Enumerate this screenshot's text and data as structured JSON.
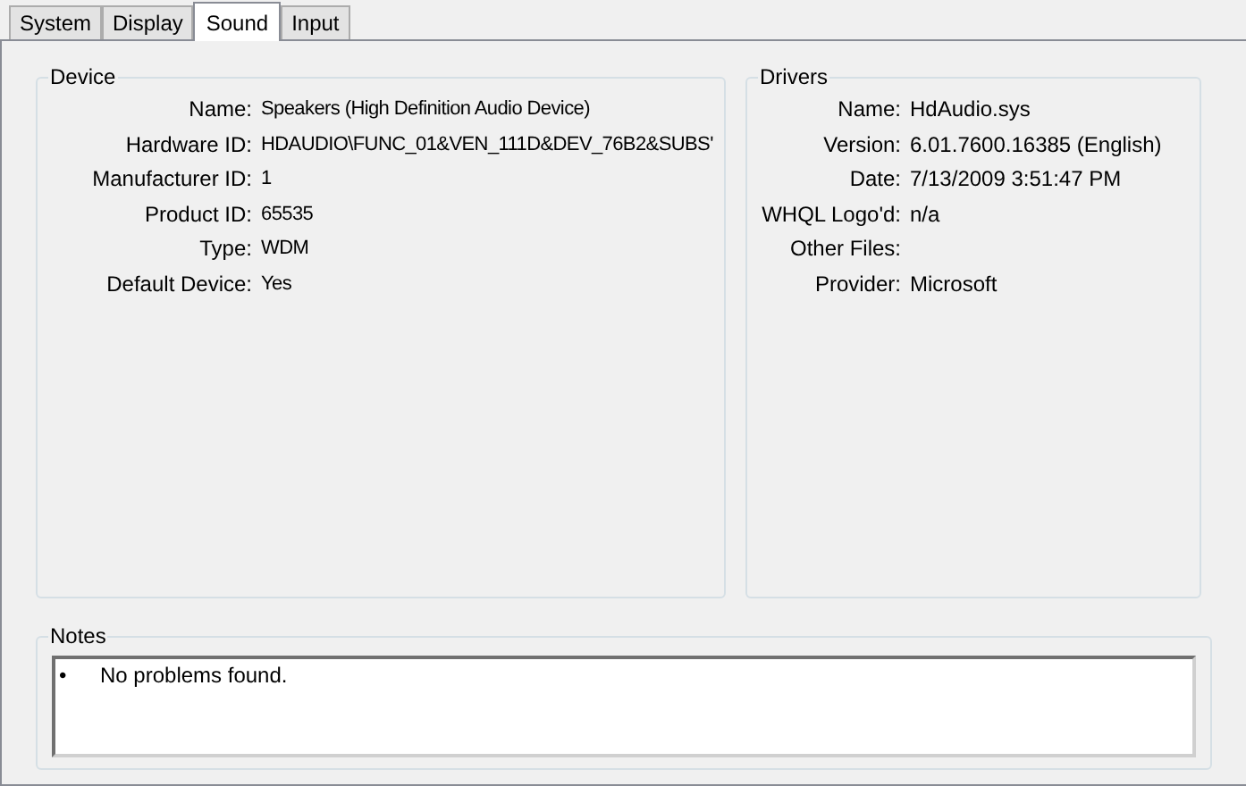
{
  "tabs": [
    {
      "label": "System",
      "selected": false
    },
    {
      "label": "Display",
      "selected": false
    },
    {
      "label": "Sound",
      "selected": true
    },
    {
      "label": "Input",
      "selected": false
    }
  ],
  "device": {
    "title": "Device",
    "fields": [
      {
        "label": "Name:",
        "value": "Speakers (High Definition Audio Device)"
      },
      {
        "label": "Hardware ID:",
        "value": "HDAUDIO\\FUNC_01&VEN_111D&DEV_76B2&SUBS'"
      },
      {
        "label": "Manufacturer ID:",
        "value": "1"
      },
      {
        "label": "Product ID:",
        "value": "65535"
      },
      {
        "label": "Type:",
        "value": "WDM"
      },
      {
        "label": "Default Device:",
        "value": "Yes"
      }
    ]
  },
  "drivers": {
    "title": "Drivers",
    "fields": [
      {
        "label": "Name:",
        "value": "HdAudio.sys"
      },
      {
        "label": "Version:",
        "value": "6.01.7600.16385 (English)"
      },
      {
        "label": "Date:",
        "value": "7/13/2009 3:51:47 PM"
      },
      {
        "label": "WHQL Logo'd:",
        "value": "n/a"
      },
      {
        "label": "Other Files:"
      },
      {
        "label": "Provider:",
        "value": "Microsoft"
      }
    ]
  },
  "notes": {
    "title": "Notes",
    "items": [
      {
        "bullet": "•",
        "text": "No problems found."
      }
    ]
  }
}
